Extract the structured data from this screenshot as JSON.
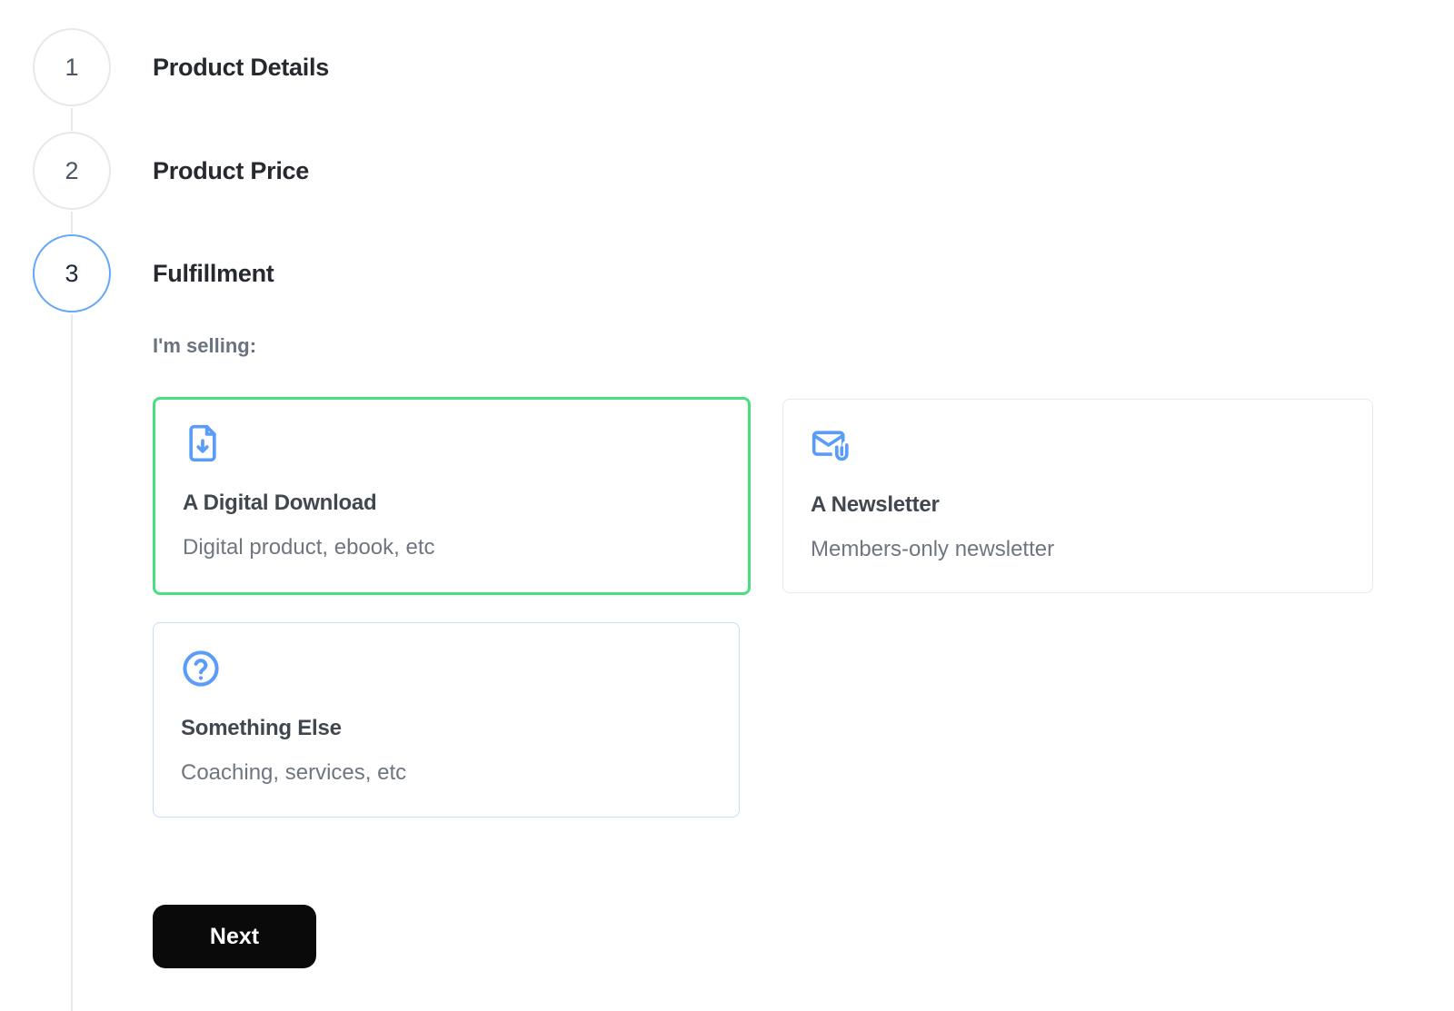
{
  "stepper": {
    "steps": [
      {
        "number": "1",
        "label": "Product Details",
        "state": "upcoming"
      },
      {
        "number": "2",
        "label": "Product Price",
        "state": "upcoming"
      },
      {
        "number": "3",
        "label": "Fulfillment",
        "state": "active"
      }
    ]
  },
  "fulfillment": {
    "prompt": "I'm selling:",
    "options": [
      {
        "icon": "file-download-icon",
        "title": "A Digital Download",
        "description": "Digital product, ebook, etc",
        "selected": true
      },
      {
        "icon": "mail-attachment-icon",
        "title": "A Newsletter",
        "description": "Members-only newsletter",
        "selected": false
      },
      {
        "icon": "help-circle-icon",
        "title": "Something Else",
        "description": "Coaching, services, etc",
        "selected": false
      }
    ],
    "next_label": "Next"
  },
  "colors": {
    "icon_blue": "#5b9cf7",
    "active_step_blue": "#64a8f6",
    "selected_border_green": "#4ade80",
    "highlight_border_blue": "#c7ddfb",
    "card_border_gray": "#e7e9ec",
    "button_black": "#0a0a0a"
  }
}
